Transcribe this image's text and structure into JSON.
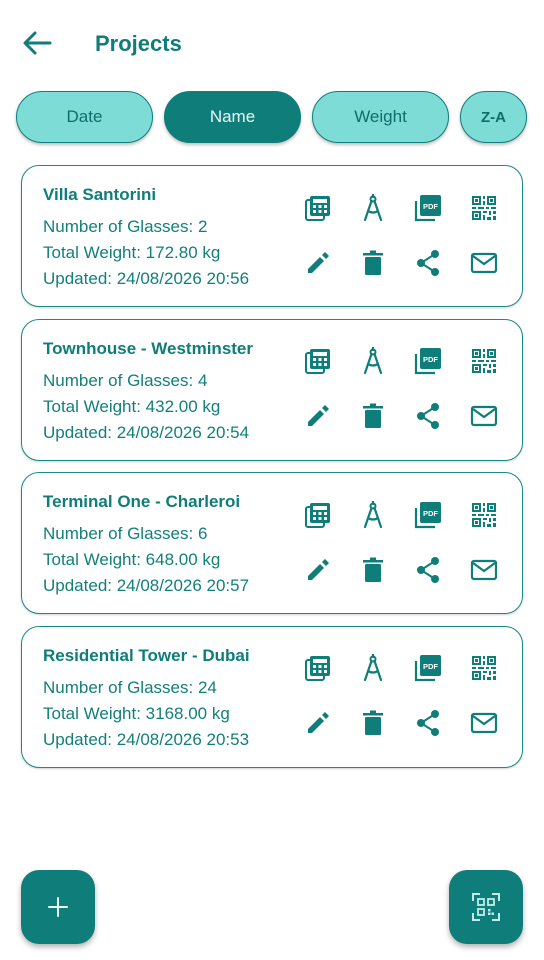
{
  "header": {
    "title": "Projects",
    "back_icon": "arrow-back-icon"
  },
  "sort_chips": [
    {
      "label": "Date",
      "active": false
    },
    {
      "label": "Name",
      "active": true
    },
    {
      "label": "Weight",
      "active": false
    },
    {
      "label": "Z-A",
      "active": false
    }
  ],
  "projects": [
    {
      "name": "Villa Santorini",
      "glasses": "Number of Glasses: 2",
      "weight": "Total Weight: 172.80 kg",
      "updated": "Updated: 24/08/2026 20:56"
    },
    {
      "name": "Townhouse - Westminster",
      "glasses": "Number of Glasses: 4",
      "weight": "Total Weight: 432.00 kg",
      "updated": "Updated: 24/08/2026 20:54"
    },
    {
      "name": "Terminal One - Charleroi",
      "glasses": "Number of Glasses: 6",
      "weight": "Total Weight: 648.00 kg",
      "updated": "Updated: 24/08/2026 20:57"
    },
    {
      "name": "Residential Tower - Dubai",
      "glasses": "Number of Glasses: 24",
      "weight": "Total Weight: 3168.00 kg",
      "updated": "Updated: 24/08/2026 20:53"
    }
  ],
  "card_actions": [
    "calculator-icon",
    "compass-icon",
    "pdf-icon",
    "qr-code-icon",
    "edit-icon",
    "delete-icon",
    "share-icon",
    "mail-icon"
  ],
  "pdf_badge": "PDF",
  "fabs": {
    "add_icon": "add-icon",
    "scan_icon": "qr-scan-icon"
  },
  "colors": {
    "primary": "#0f7d7a",
    "chip_light": "#7ddcd6",
    "background": "#ffffff"
  }
}
